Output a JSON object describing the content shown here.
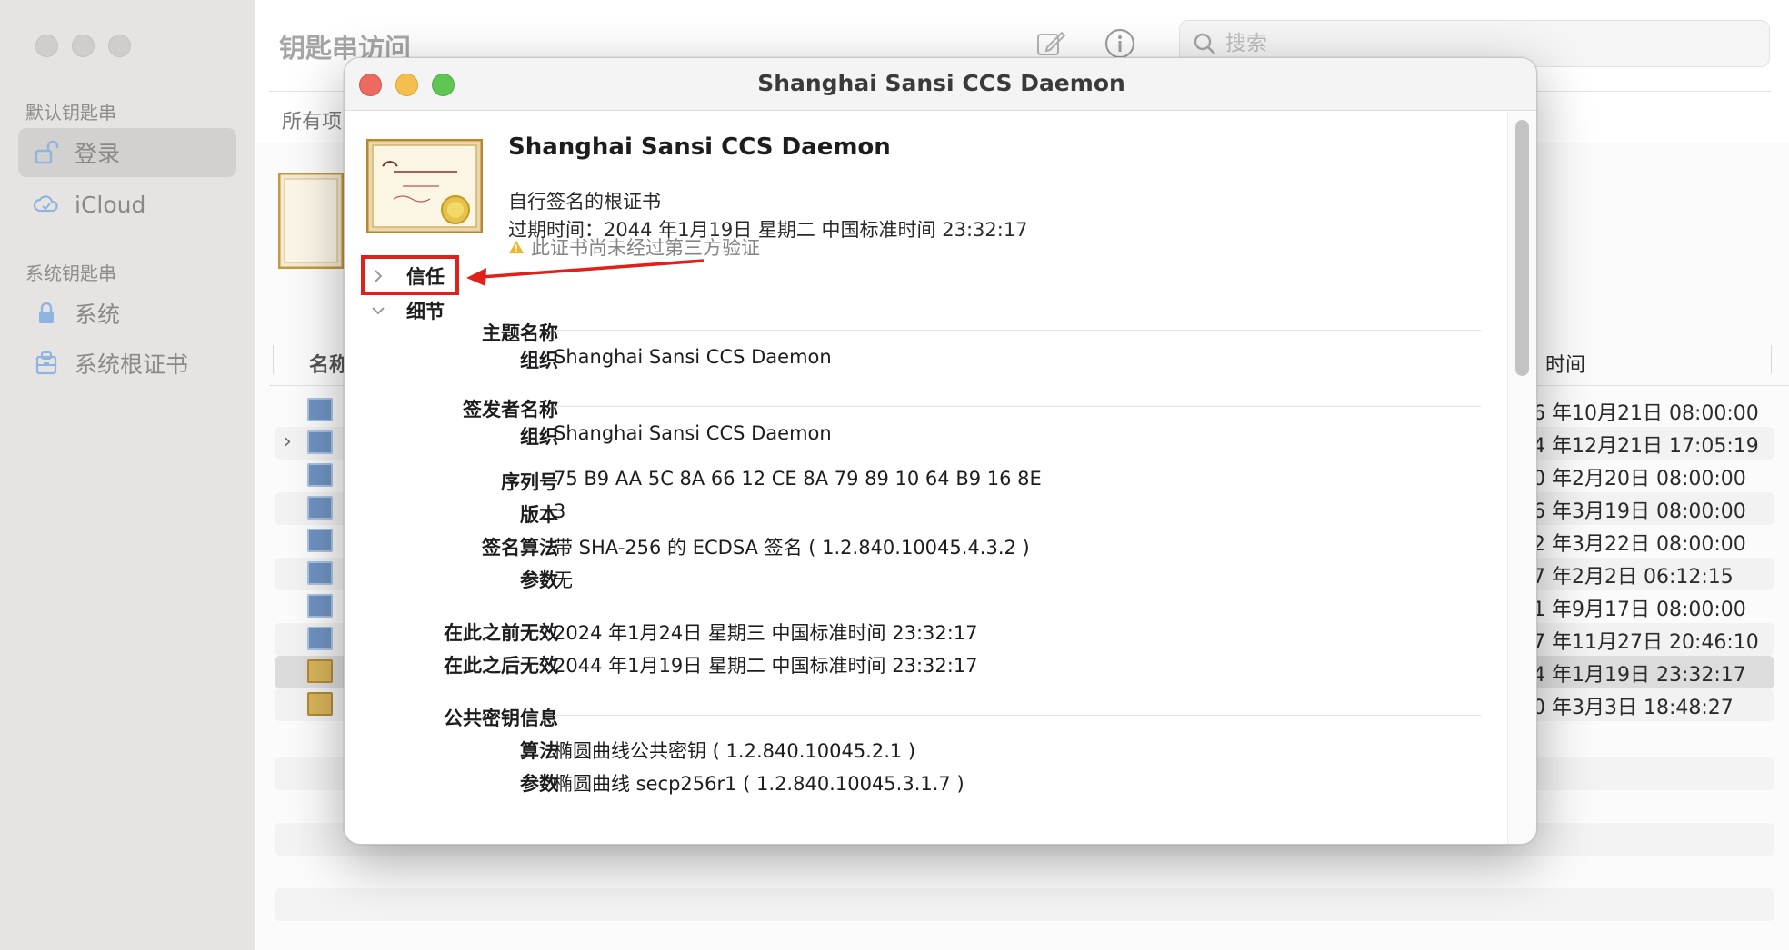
{
  "app": {
    "title": "钥匙串访问",
    "search_placeholder": "搜索",
    "filter_label": "所有项"
  },
  "sidebar": {
    "section_default": "默认钥匙串",
    "section_system": "系统钥匙串",
    "items": [
      {
        "label": "登录",
        "icon": "unlock-icon",
        "selected": true
      },
      {
        "label": "iCloud",
        "icon": "cloud-icon",
        "selected": false
      },
      {
        "label": "系统",
        "icon": "lock-icon",
        "selected": false
      },
      {
        "label": "系统根证书",
        "icon": "cabinet-icon",
        "selected": false
      }
    ]
  },
  "table": {
    "col_name": "名称",
    "col_expiry": "时间",
    "rows": [
      {
        "date": "6 年10月21日 08:00:00",
        "icon": "blue"
      },
      {
        "date": "4 年12月21日 17:05:19",
        "icon": "blue",
        "expandable": true
      },
      {
        "date": "0 年2月20日 08:00:00",
        "icon": "blue"
      },
      {
        "date": "6 年3月19日 08:00:00",
        "icon": "blue"
      },
      {
        "date": "2 年3月22日 08:00:00",
        "icon": "blue"
      },
      {
        "date": "7 年2月2日 06:12:15",
        "icon": "blue"
      },
      {
        "date": "1 年9月17日 08:00:00",
        "icon": "blue"
      },
      {
        "date": "7 年11月27日 20:46:10",
        "icon": "blue"
      },
      {
        "date": "4 年1月19日 23:32:17",
        "icon": "gold",
        "selected": true
      },
      {
        "date": "0 年3月3日 18:48:27",
        "icon": "gold"
      }
    ]
  },
  "dialog": {
    "title": "Shanghai Sansi CCS Daemon",
    "cert_name": "Shanghai Sansi CCS Daemon",
    "cert_type": "自行签名的根证书",
    "expiry": "过期时间：2044 年1月19日 星期二 中国标准时间 23:32:17",
    "warning": "此证书尚未经过第三方验证",
    "trust_label": "信任",
    "details_label": "细节",
    "subject": {
      "section": "主题名称",
      "org_key": "组织",
      "org_val": "Shanghai Sansi CCS Daemon"
    },
    "issuer": {
      "section": "签发者名称",
      "org_key": "组织",
      "org_val": "Shanghai Sansi CCS Daemon"
    },
    "serial_key": "序列号",
    "serial_val": "75 B9 AA 5C 8A 66 12 CE 8A 79 89 10 64 B9 16 8E",
    "version_key": "版本",
    "version_val": "3",
    "sigalg_key": "签名算法",
    "sigalg_val": "带 SHA-256 的 ECDSA 签名 ( 1.2.840.10045.4.3.2 )",
    "params_key": "参数",
    "params_val": "无",
    "not_before_key": "在此之前无效",
    "not_before_val": "2024 年1月24日 星期三 中国标准时间 23:32:17",
    "not_after_key": "在此之后无效",
    "not_after_val": "2044 年1月19日 星期二 中国标准时间 23:32:17",
    "pubkey": {
      "section": "公共密钥信息",
      "alg_key": "算法",
      "alg_val": "椭圆曲线公共密钥 ( 1.2.840.10045.2.1 )",
      "params_key": "参数",
      "params_val": "椭圆曲线 secp256r1 ( 1.2.840.10045.3.1.7 )"
    }
  },
  "colors": {
    "close": "#ed6a5e",
    "minimize": "#f5bf4f",
    "zoom": "#61c554",
    "highlight": "#e0201a"
  }
}
